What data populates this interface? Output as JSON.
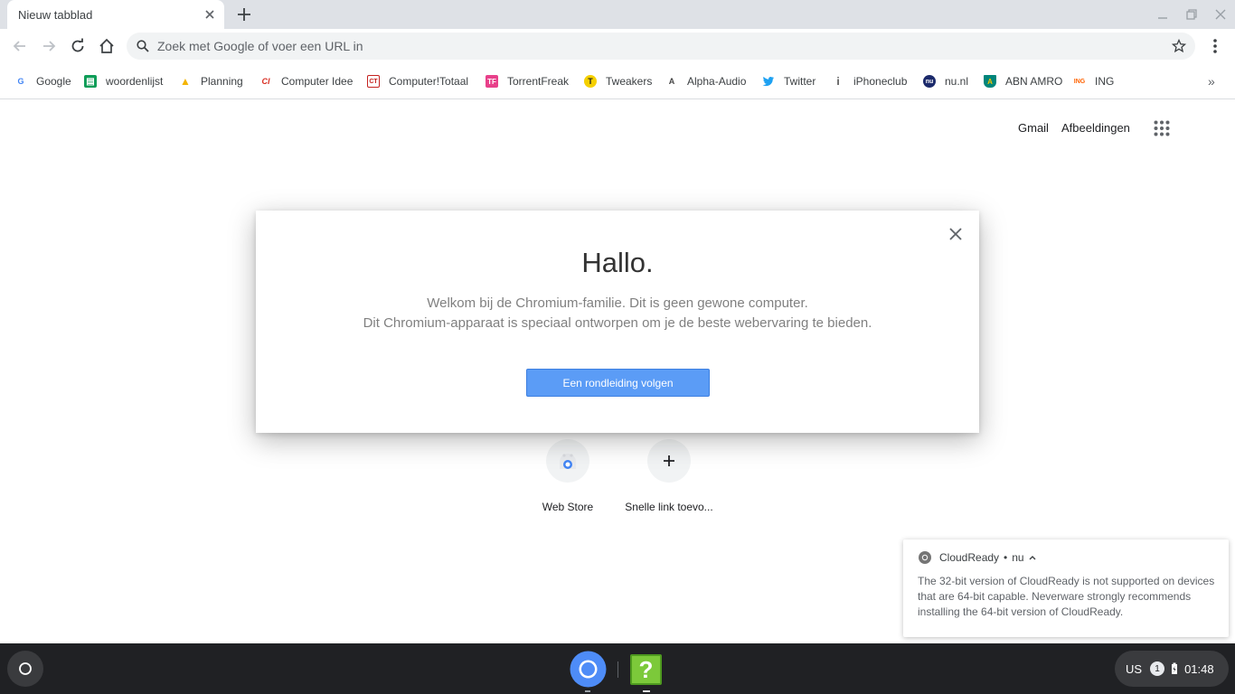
{
  "tab": {
    "title": "Nieuw tabblad"
  },
  "omnibox": {
    "placeholder": "Zoek met Google of voer een URL in"
  },
  "bookmarks": [
    {
      "label": "Google",
      "icon": "G",
      "color": "#4285f4"
    },
    {
      "label": "woordenlijst",
      "icon": "▤",
      "color": "#0f9d58"
    },
    {
      "label": "Planning",
      "icon": "▲",
      "color": "#f4b400"
    },
    {
      "label": "Computer Idee",
      "icon": "CI",
      "color": "#d93025"
    },
    {
      "label": "Computer!Totaal",
      "icon": "CT",
      "color": "#c5221f"
    },
    {
      "label": "TorrentFreak",
      "icon": "TF",
      "color": "#e8408a"
    },
    {
      "label": "Tweakers",
      "icon": "T",
      "color": "#2e7d32"
    },
    {
      "label": "Alpha-Audio",
      "icon": "A",
      "color": "#444444"
    },
    {
      "label": "Twitter",
      "icon": "t",
      "color": "#1da1f2"
    },
    {
      "label": "iPhoneclub",
      "icon": "i",
      "color": "#555555"
    },
    {
      "label": "nu.nl",
      "icon": "nu",
      "color": "#1c2a6b"
    },
    {
      "label": "ABN AMRO",
      "icon": "A",
      "color": "#00857a"
    },
    {
      "label": "ING",
      "icon": "ING",
      "color": "#ff6200"
    }
  ],
  "ntp": {
    "gmail": "Gmail",
    "images": "Afbeeldingen",
    "shortcuts": [
      {
        "label": "Web Store"
      },
      {
        "label": "Snelle link toevo..."
      }
    ]
  },
  "dialog": {
    "title": "Hallo.",
    "line1": "Welkom bij de Chromium-familie. Dit is geen gewone computer.",
    "line2": "Dit Chromium-apparaat is speciaal ontworpen om je de beste webervaring te bieden.",
    "button": "Een rondleiding volgen"
  },
  "notification": {
    "app": "CloudReady",
    "time": "nu",
    "body": "The 32-bit version of CloudReady is not supported on devices that are 64-bit capable. Neverware strongly recommends installing the 64-bit version of CloudReady."
  },
  "shelf": {
    "keyboard": "US",
    "notification_count": "1",
    "time": "01:48"
  }
}
